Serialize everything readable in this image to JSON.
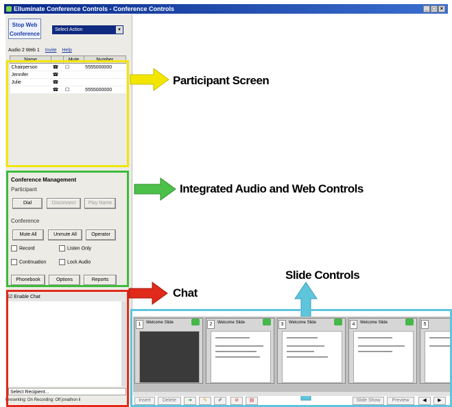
{
  "window": {
    "title": "Elluminate Conference Controls - Conference Controls"
  },
  "controls": {
    "stop_button": "Stop Web Conference",
    "select_action": "Select Action"
  },
  "participant_bar": {
    "counts": "Audio 2  Web 1",
    "invite": "Invite",
    "help": "Help"
  },
  "participants": {
    "columns": [
      "Name",
      "",
      "Mute",
      "Number"
    ],
    "rows": [
      {
        "name": "Chairperson",
        "number": "5555000000"
      },
      {
        "name": "Jennifer",
        "number": ""
      },
      {
        "name": "Julie",
        "number": ""
      },
      {
        "name": "",
        "number": "5555000000"
      }
    ]
  },
  "management": {
    "title": "Conference Management",
    "participant_group": "Participant",
    "dial": "Dial",
    "disconnect": "Disconnect",
    "play_name": "Play Name",
    "conference_group": "Conference",
    "mute_all": "Mute All",
    "unmute_all": "Unmute All",
    "operator": "Operator",
    "record": "Record",
    "listen_only": "Listen Only",
    "continuation": "Continuation",
    "lock_audio": "Lock Audio",
    "phonebook": "Phonebook",
    "options": "Options",
    "reports": "Reports"
  },
  "chat": {
    "enable_label": "Enable Chat",
    "select_recipient": "Select Recipient..."
  },
  "status": {
    "text": "Presenting: On   Recording: Off   jonathon li"
  },
  "annotations": {
    "participant_screen": "Participant Screen",
    "audio_web": "Integrated Audio and Web Controls",
    "chat": "Chat",
    "slide_controls": "Slide Controls"
  },
  "slides": [
    {
      "num": "1",
      "title": "Welcome Slide"
    },
    {
      "num": "2",
      "title": "Welcome Slide"
    },
    {
      "num": "3",
      "title": "Welcome Slide"
    },
    {
      "num": "4",
      "title": "Welcome Slide"
    },
    {
      "num": "5",
      "title": ""
    }
  ],
  "bottom": {
    "insert": "Insert",
    "delete": "Delete",
    "slide_show": "Slide Show",
    "preview": "Preview"
  },
  "colors": {
    "participant_box": "#f2e600",
    "audio_box": "#3dbb3a",
    "chat_box": "#e02a1a",
    "slide_box": "#5ec5dc"
  }
}
